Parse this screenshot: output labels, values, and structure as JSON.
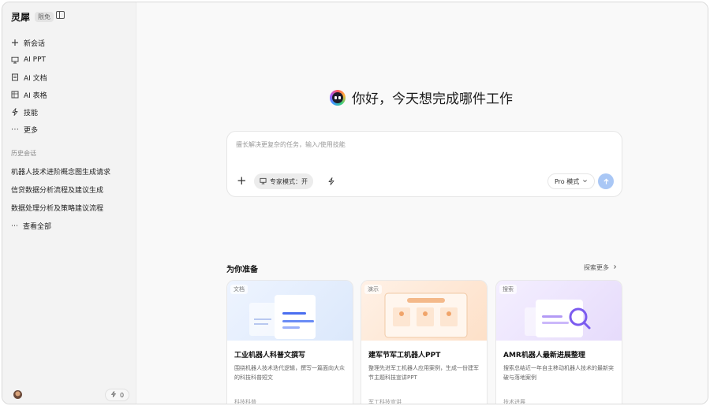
{
  "sidebar": {
    "brand": "灵犀",
    "badge": "限免",
    "nav": [
      {
        "icon": "plus-icon",
        "label": "新会话"
      },
      {
        "icon": "presentation-icon",
        "label": "AI PPT"
      },
      {
        "icon": "document-icon",
        "label": "AI 文档"
      },
      {
        "icon": "table-icon",
        "label": "AI 表格"
      },
      {
        "icon": "bolt-icon",
        "label": "技能"
      },
      {
        "icon": "ellipsis-icon",
        "label": "更多"
      }
    ],
    "history_title": "历史会话",
    "history": [
      "机器人技术进阶概念图生成请求",
      "信贷数据分析流程及建议生成",
      "数据处理分析及策略建议流程"
    ],
    "history_more": "查看全部",
    "credits": "0"
  },
  "main": {
    "greeting": "你好，今天想完成哪件工作",
    "composer": {
      "placeholder": "擅长解决更复杂的任务，输入/使用技能",
      "expert_mode": "专家模式：开",
      "model": "Pro 模式"
    },
    "section_title": "为你准备",
    "explore_more": "探索更多",
    "cards": [
      {
        "tag": "文档",
        "title": "工业机器人科普文撰写",
        "desc": "围绕机器人技术迭代逻辑，撰写一篇面向大众的科技科普短文",
        "category": "科技科普"
      },
      {
        "tag": "演示",
        "title": "建军节军工机器人PPT",
        "desc": "整理先进军工机器人应用案例，生成一份建军节主题科技宣讲PPT",
        "category": "军工科技宣讲"
      },
      {
        "tag": "搜索",
        "title": "AMR机器人最新进展整理",
        "desc": "搜索总结近一年自主移动机器人技术的最新突破与落地案例",
        "category": "技术进展"
      }
    ]
  },
  "colors": {
    "accent": "#7fd3c0",
    "send_button": "#a9c7f5",
    "sidebar_bg": "#f3f3f3"
  }
}
